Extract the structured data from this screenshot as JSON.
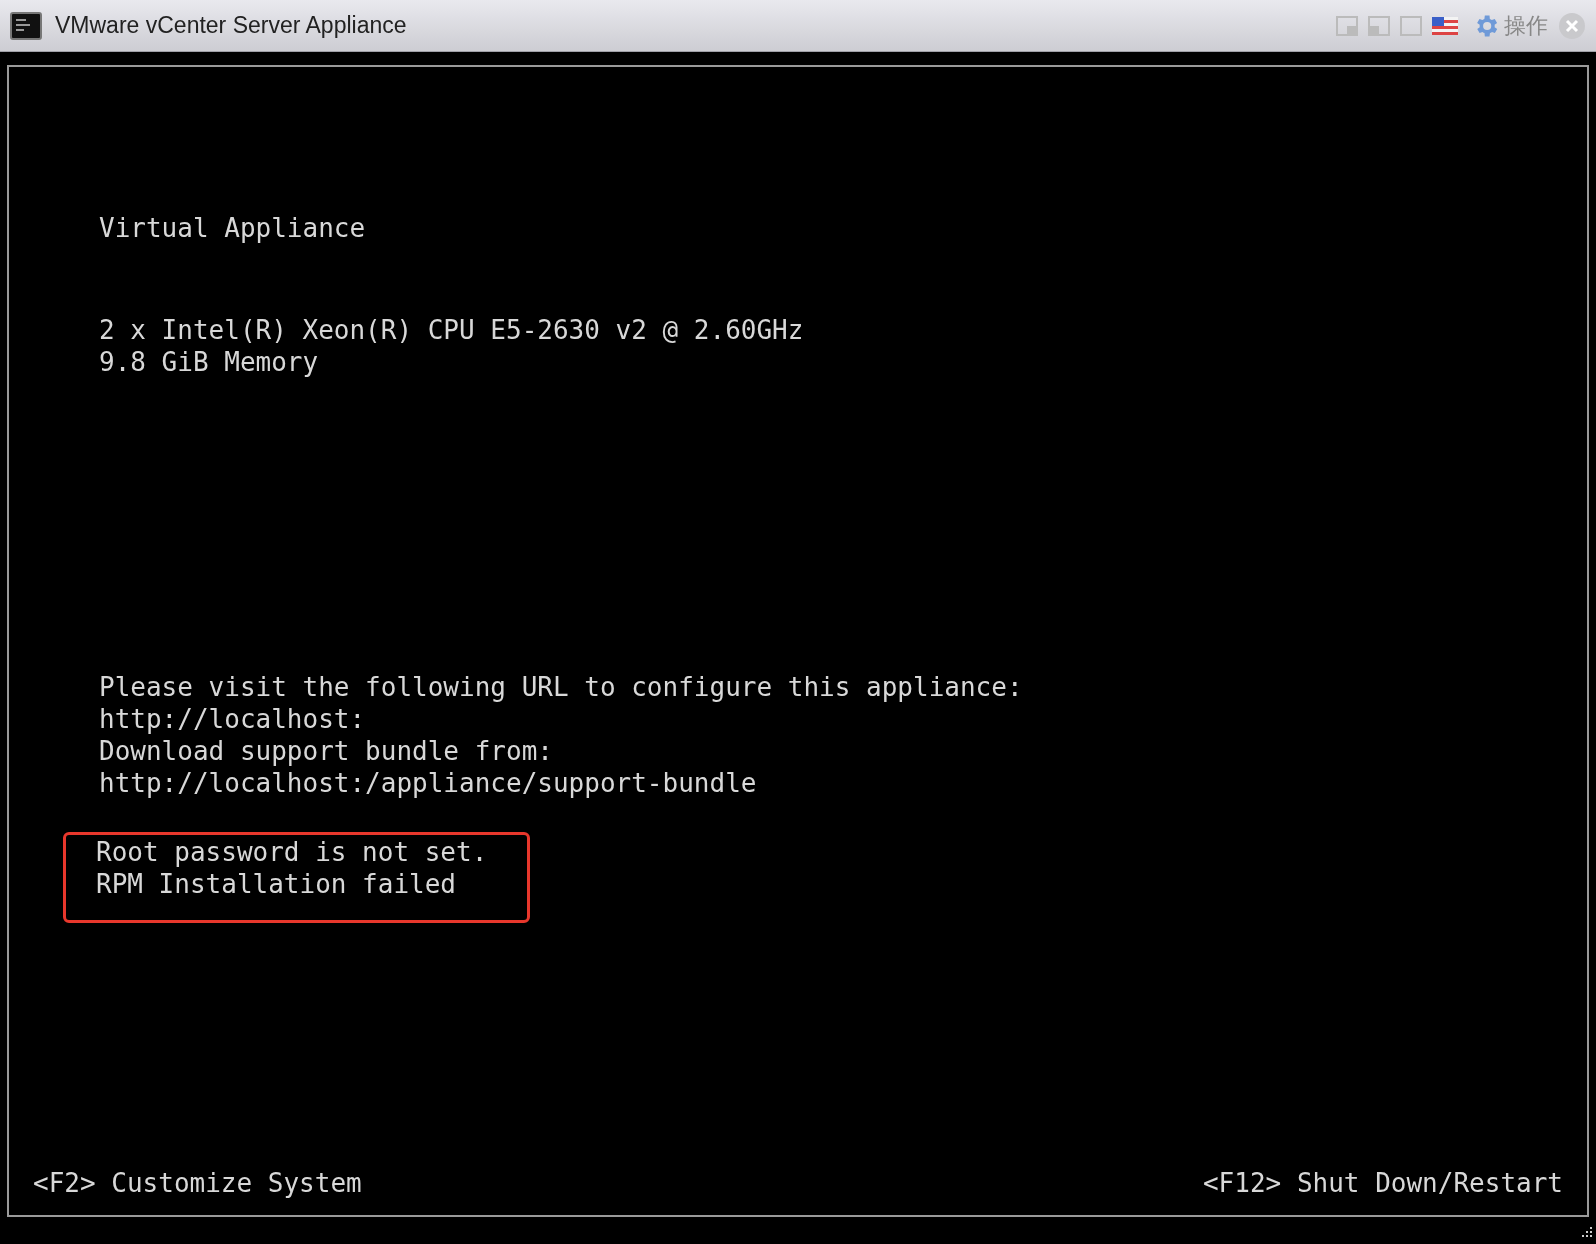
{
  "window": {
    "title": "VMware vCenter Server Appliance"
  },
  "toolbar": {
    "action_label": "操作"
  },
  "console": {
    "blocks": [
      {
        "lines": [
          "Virtual Appliance"
        ],
        "annotated": false
      },
      {
        "lines": [
          "2 x Intel(R) Xeon(R) CPU E5-2630 v2 @ 2.60GHz",
          "9.8 GiB Memory"
        ],
        "annotated": false
      },
      {
        "lines": [
          "Please visit the following URL to configure this appliance:",
          "http://localhost:",
          "Download support bundle from:",
          "http://localhost:/appliance/support-bundle"
        ],
        "annotated": false
      },
      {
        "lines": [
          "Root password is not set.",
          "RPM Installation failed"
        ],
        "annotated": true
      }
    ],
    "footer": {
      "left": "<F2> Customize System",
      "right": "<F12> Shut Down/Restart"
    }
  }
}
